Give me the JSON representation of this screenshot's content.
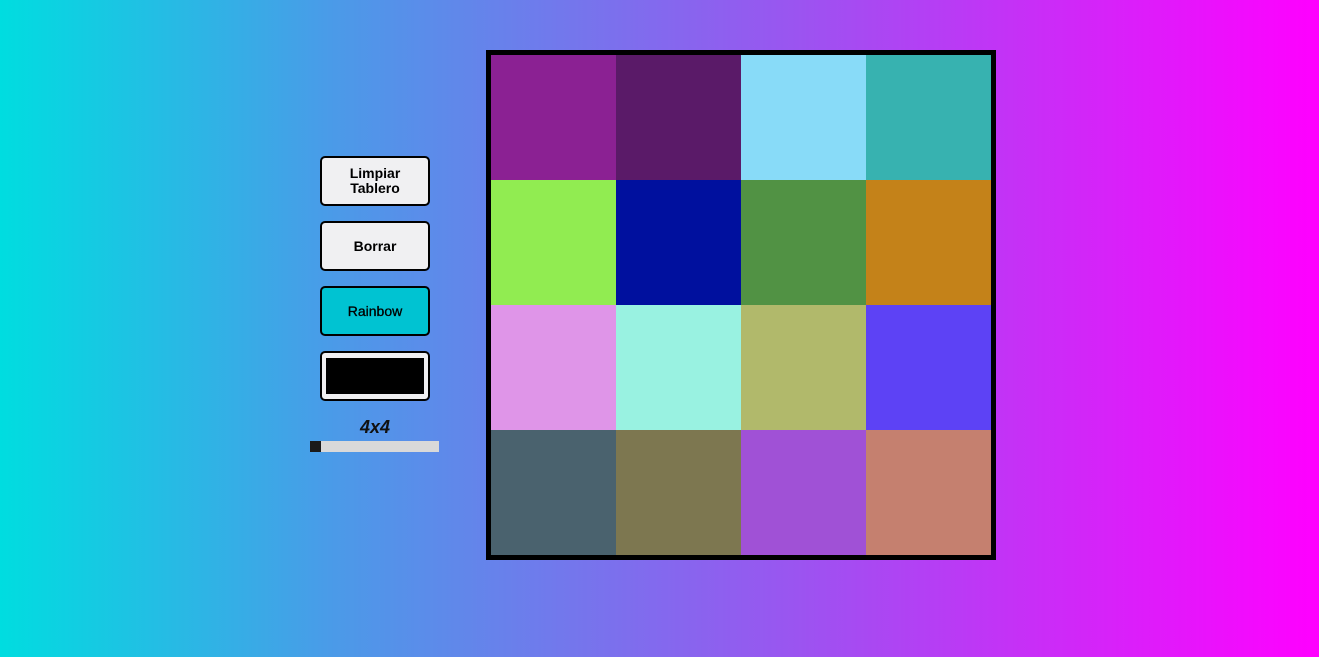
{
  "controls": {
    "clear_label": "Limpiar Tablero",
    "erase_label": "Borrar",
    "rainbow_label": "Rainbow",
    "selected_color": "#000000",
    "size_label": "4x4",
    "size_value": 4,
    "size_min": 4,
    "size_max": 64
  },
  "board": {
    "rows": 4,
    "cols": 4,
    "cells": [
      "#8b2193",
      "#5a1a68",
      "#88dbf8",
      "#37b2b0",
      "#91ec51",
      "#00109e",
      "#519244",
      "#c48219",
      "#df95e8",
      "#99f2e1",
      "#b1b96b",
      "#5d42f5",
      "#4a626e",
      "#7d7750",
      "#a051d6",
      "#c5806f"
    ]
  }
}
